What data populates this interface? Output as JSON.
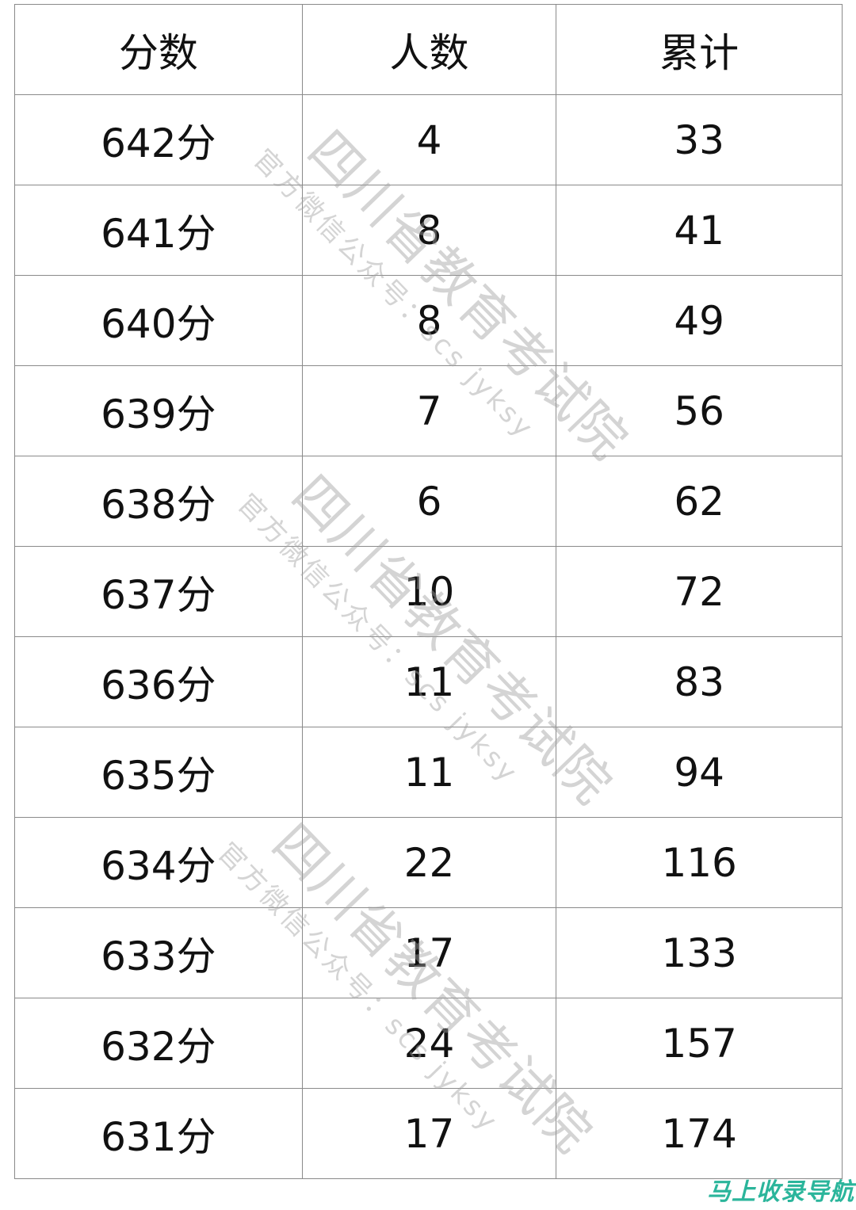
{
  "table": {
    "headers": [
      "分数",
      "人数",
      "累计"
    ],
    "rows": [
      [
        "642分",
        "4",
        "33"
      ],
      [
        "641分",
        "8",
        "41"
      ],
      [
        "640分",
        "8",
        "49"
      ],
      [
        "639分",
        "7",
        "56"
      ],
      [
        "638分",
        "6",
        "62"
      ],
      [
        "637分",
        "10",
        "72"
      ],
      [
        "636分",
        "11",
        "83"
      ],
      [
        "635分",
        "11",
        "94"
      ],
      [
        "634分",
        "22",
        "116"
      ],
      [
        "633分",
        "17",
        "133"
      ],
      [
        "632分",
        "24",
        "157"
      ],
      [
        "631分",
        "17",
        "174"
      ]
    ]
  },
  "watermark": {
    "title": "四川省教育考试院",
    "subtitle": "官方微信公众号：scs jyksy"
  },
  "brand": {
    "text": "马上收录导航",
    "color": "#2bb59b"
  }
}
